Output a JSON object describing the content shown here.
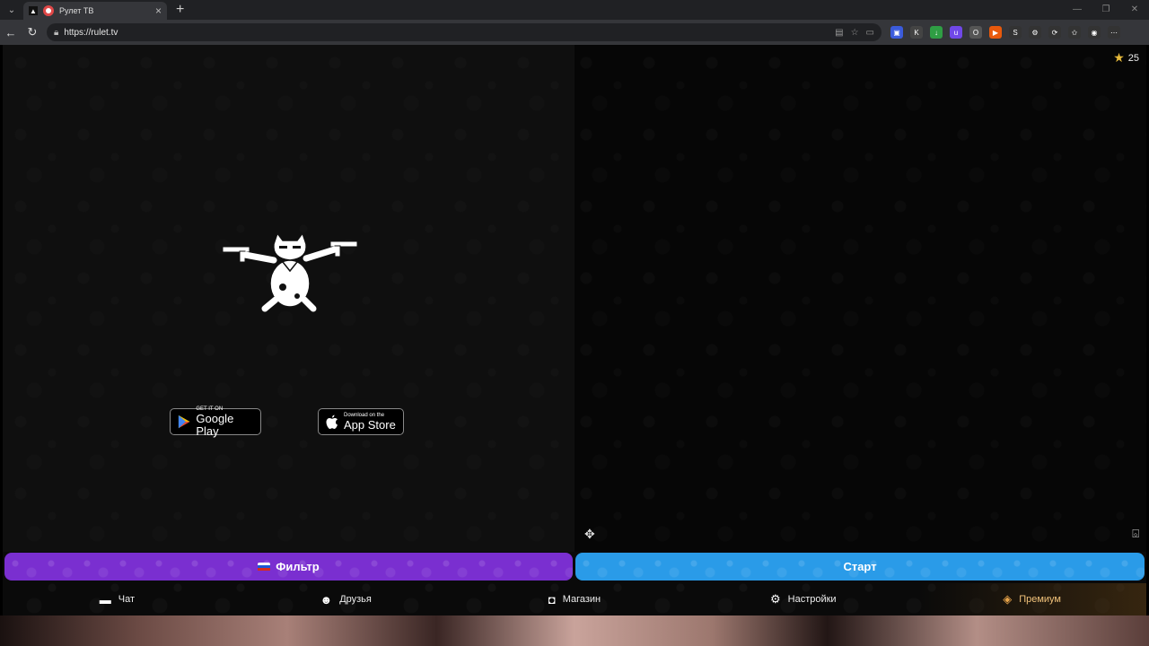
{
  "browser": {
    "tab_title": "Рулет ТВ",
    "url": "https://rulet.tv"
  },
  "balance": {
    "count": "25",
    "icon": "star-icon"
  },
  "stores": {
    "google": {
      "small": "GET IT ON",
      "big": "Google Play"
    },
    "apple": {
      "small": "Download on the",
      "big": "App Store"
    }
  },
  "actions": {
    "filter_label": "Фильтр",
    "start_label": "Старт"
  },
  "nav": [
    {
      "label": "Чат",
      "icon": "chat-icon"
    },
    {
      "label": "Друзья",
      "icon": "friends-icon"
    },
    {
      "label": "Магазин",
      "icon": "shop-bag-icon"
    },
    {
      "label": "Настройки",
      "icon": "gear-icon"
    },
    {
      "label": "Премиум",
      "icon": "tag-icon"
    }
  ],
  "colors": {
    "filter": "#7a2fd0",
    "start": "#2a9be8",
    "premium": "#f1c27a"
  }
}
